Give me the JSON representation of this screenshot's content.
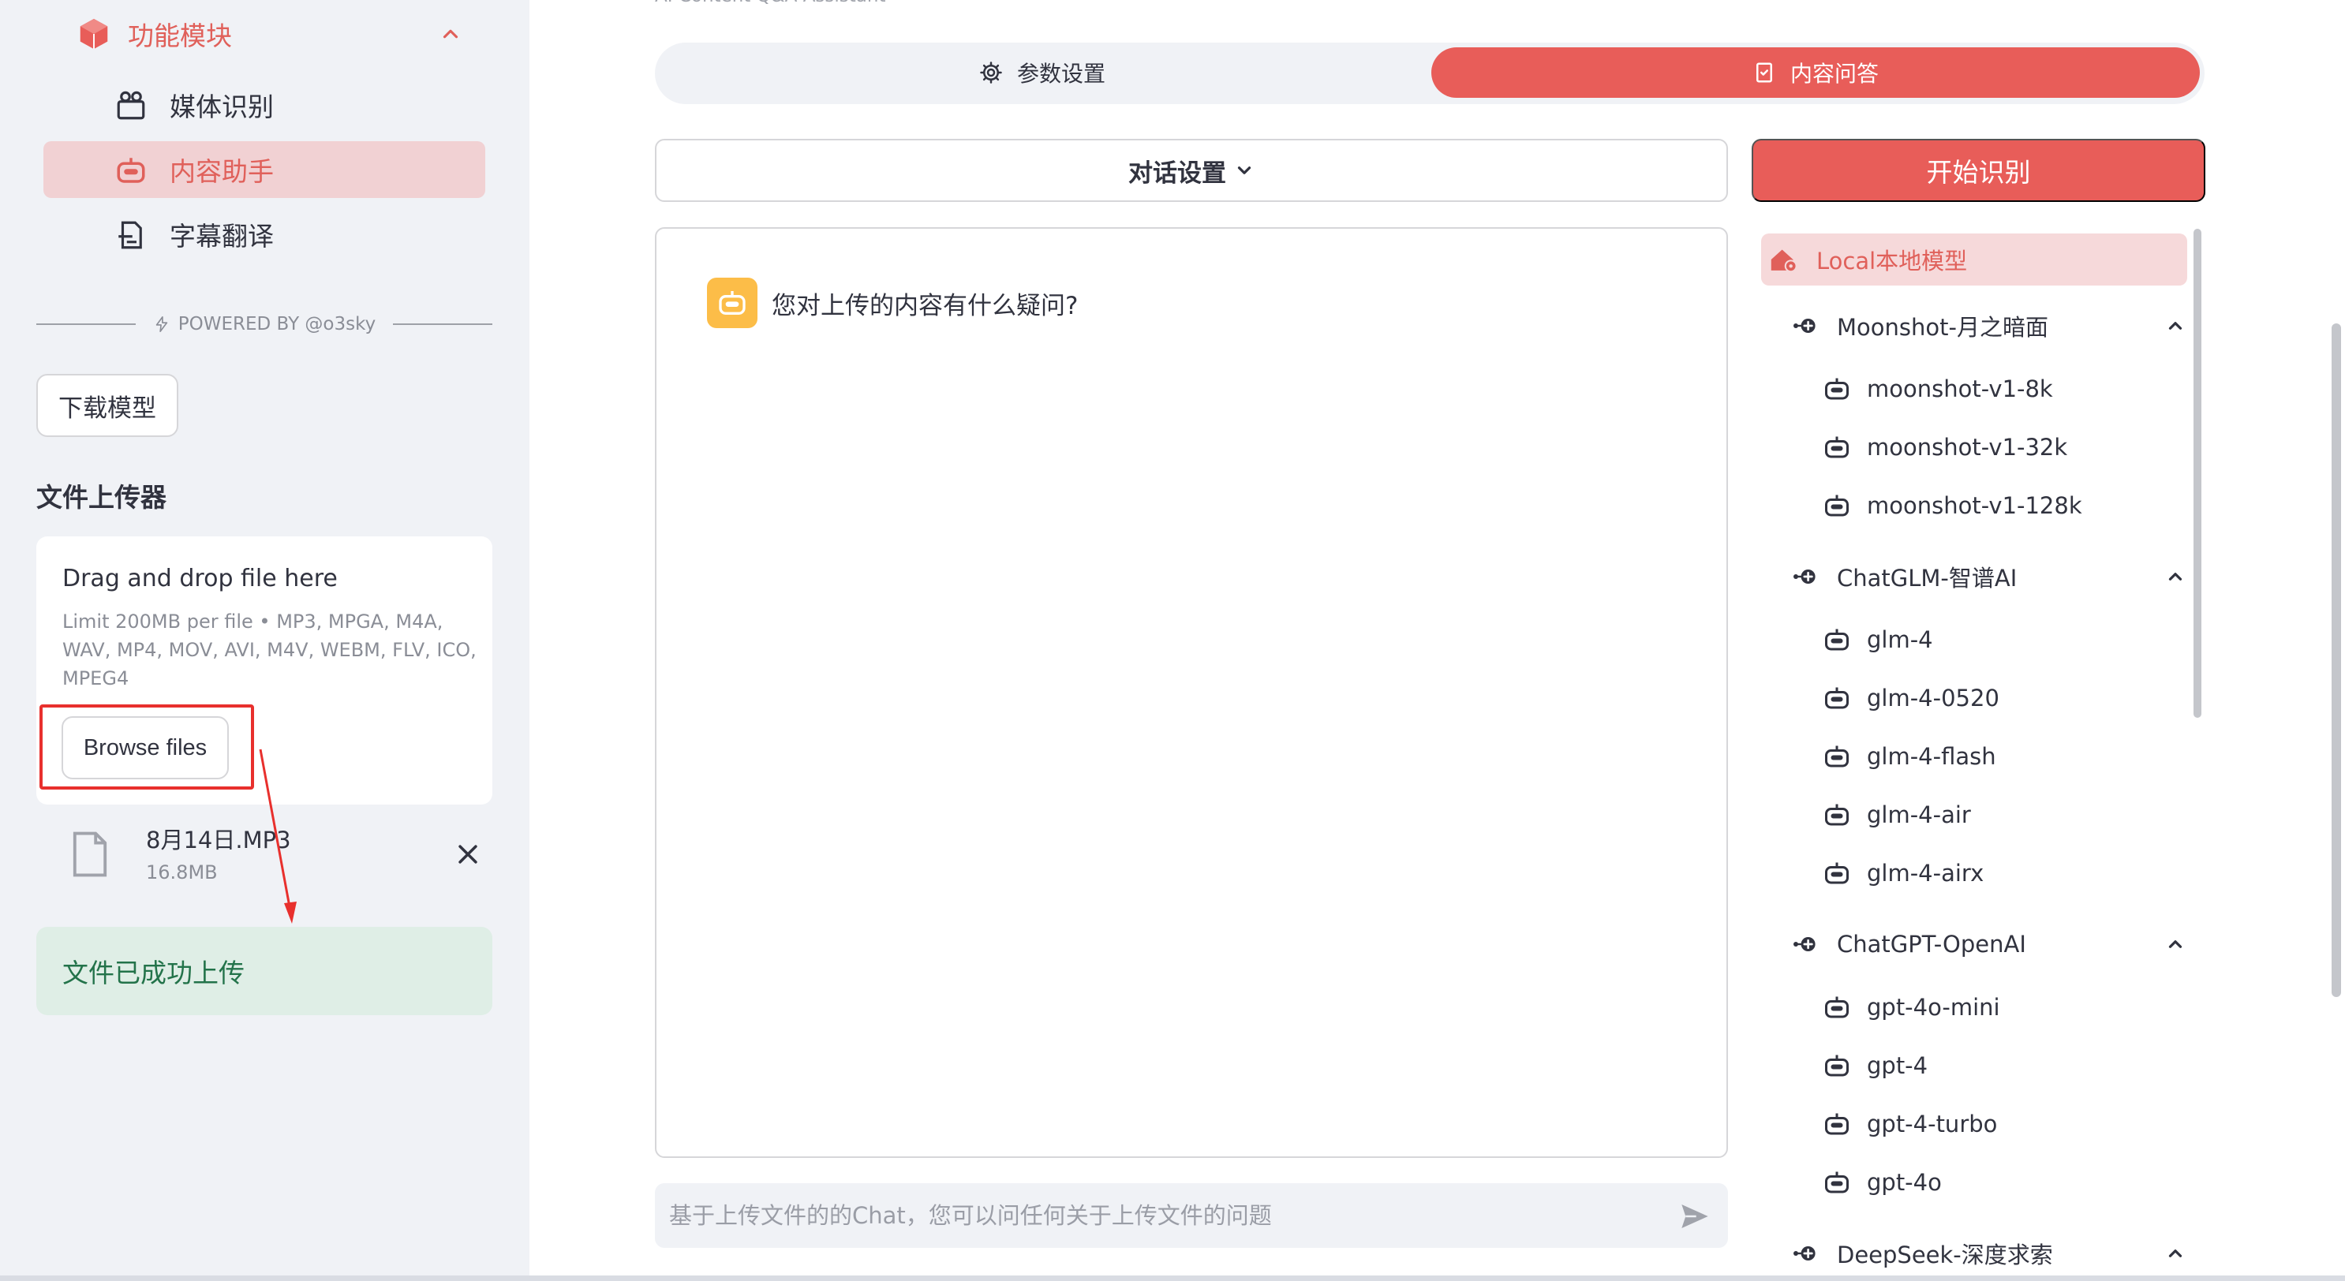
{
  "colors": {
    "accent": "#e85d59",
    "accent_soft": "#f1d1d3",
    "success_bg": "#dfeee6",
    "success_text": "#23734a",
    "annotation_red": "#e8302d"
  },
  "sidebar": {
    "section": {
      "label": "功能模块",
      "icon": "cube-icon",
      "expanded": true
    },
    "menu_items": [
      {
        "label": "媒体识别",
        "icon": "media-icon",
        "active": false
      },
      {
        "label": "内容助手",
        "icon": "robot-icon",
        "active": true
      },
      {
        "label": "字幕翻译",
        "icon": "document-icon",
        "active": false
      }
    ],
    "powered_by": "POWERED BY @o3sky",
    "download_button": "下载模型",
    "uploader": {
      "title": "文件上传器",
      "drop_title": "Drag and drop file here",
      "limit_text": "Limit 200MB per file • MP3, MPGA, M4A, WAV, MP4, MOV, AVI, M4V, WEBM, FLV, ICO, MPEG4",
      "browse_button": "Browse files",
      "file": {
        "name": "8月14日.MP3",
        "size": "16.8MB"
      },
      "success_message": "文件已成功上传"
    }
  },
  "main": {
    "subtitle": "AI Content Q&A Assistant",
    "tabs": [
      {
        "label": "参数设置",
        "icon": "gear-icon",
        "active": false
      },
      {
        "label": "内容问答",
        "icon": "checklist-icon",
        "active": true
      }
    ],
    "dialog_settings_label": "对话设置",
    "start_button": "开始识别",
    "chat": {
      "assistant_message": "您对上传的内容有什么疑问?",
      "input_placeholder": "基于上传文件的的Chat，您可以问任何关于上传文件的问题"
    }
  },
  "models": {
    "local": {
      "label": "Local本地模型",
      "icon": "home-icon"
    },
    "groups": [
      {
        "name": "Moonshot-月之暗面",
        "items": [
          "moonshot-v1-8k",
          "moonshot-v1-32k",
          "moonshot-v1-128k"
        ]
      },
      {
        "name": "ChatGLM-智谱AI",
        "items": [
          "glm-4",
          "glm-4-0520",
          "glm-4-flash",
          "glm-4-air",
          "glm-4-airx"
        ]
      },
      {
        "name": "ChatGPT-OpenAI",
        "items": [
          "gpt-4o-mini",
          "gpt-4",
          "gpt-4-turbo",
          "gpt-4o"
        ]
      },
      {
        "name": "DeepSeek-深度求索",
        "items": []
      }
    ]
  }
}
